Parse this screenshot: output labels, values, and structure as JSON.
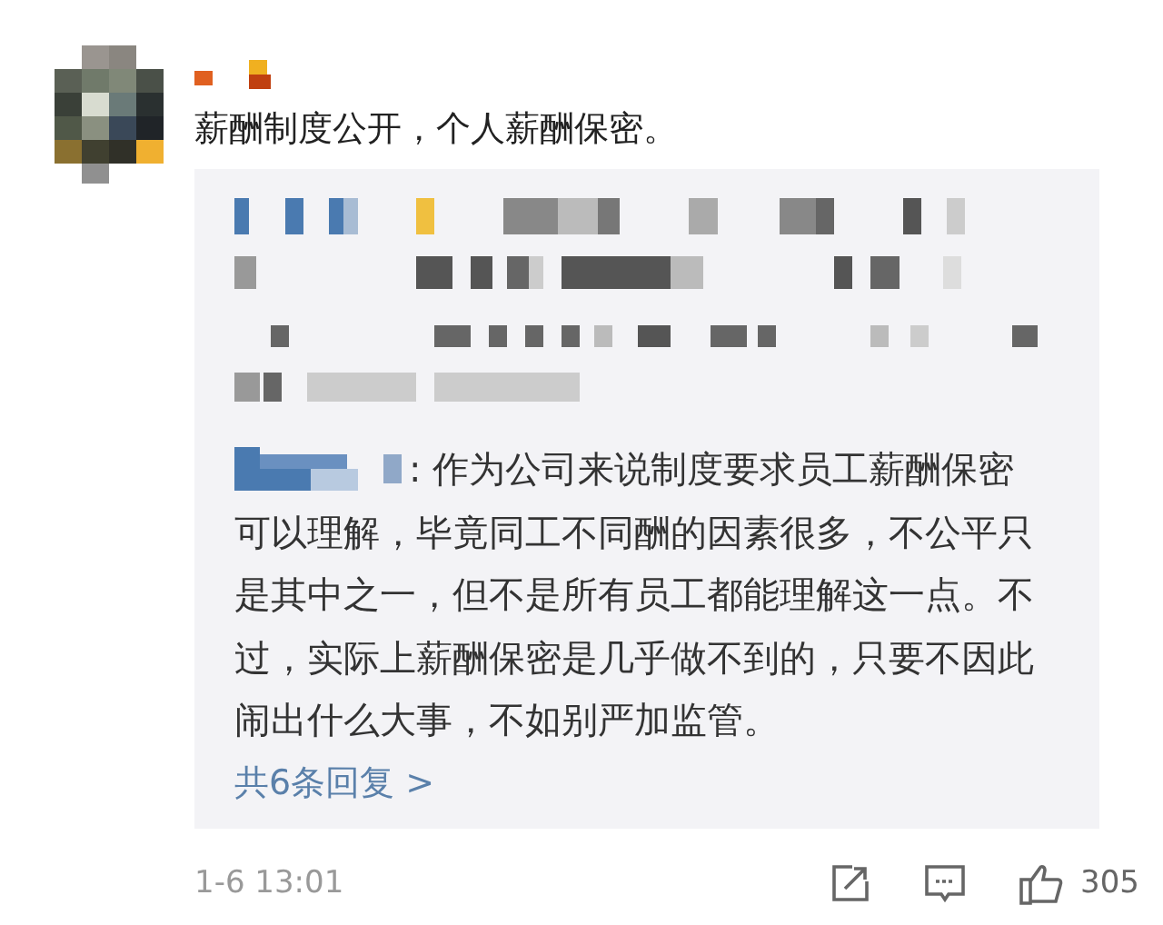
{
  "comment": {
    "text": "薪酬制度公开，个人薪酬保密。",
    "reply": {
      "lines": [
        ": 作为公司来说制度要求员工薪酬保密",
        "可以理解，毕竟同工不同酬的因素很多，不公平只",
        "是其中之一，但不是所有员工都能理解这一点。不",
        "过，实际上薪酬保密是几乎做不到的，只要不因此",
        "闹出什么大事，不如别严加监管。"
      ]
    },
    "more_replies": "共6条回复 >",
    "time": "1-6 13:01",
    "likes": "305"
  }
}
